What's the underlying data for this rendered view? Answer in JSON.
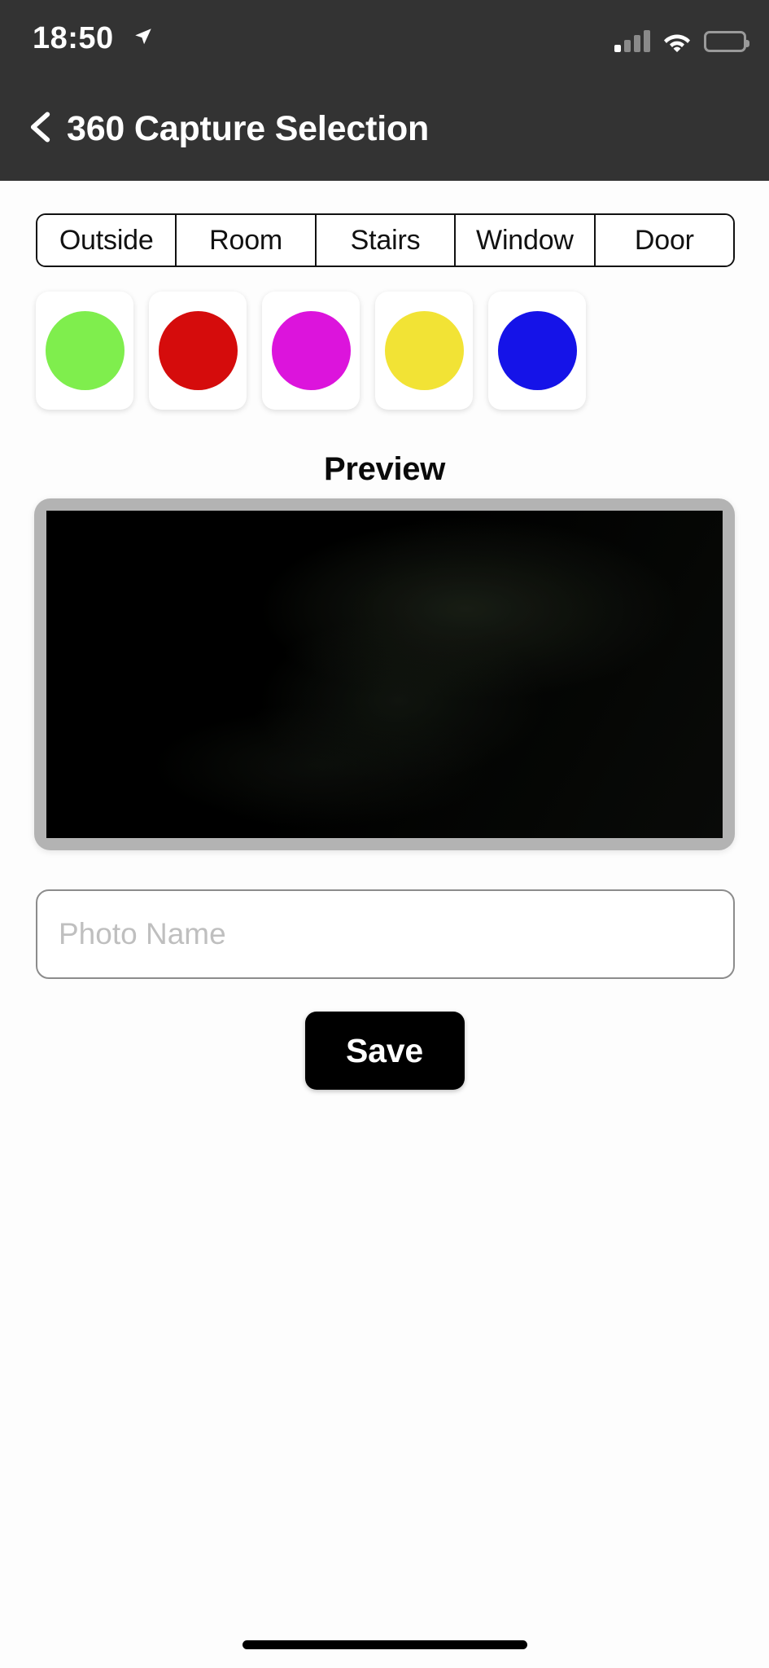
{
  "status_bar": {
    "time": "18:50",
    "location_icon": "location-arrow-icon",
    "signal_icon": "cellular-signal-icon",
    "signal_bars_active": 1,
    "signal_bars_total": 4,
    "wifi_icon": "wifi-icon",
    "battery_icon": "battery-icon",
    "battery_level_percent": 15,
    "battery_color": "#f01c1c",
    "background": "#333333"
  },
  "navbar": {
    "back_icon": "chevron-left-icon",
    "title": "360 Capture Selection",
    "background": "#333333",
    "text_color": "#ffffff"
  },
  "segmented_control": {
    "options": [
      {
        "label": "Outside"
      },
      {
        "label": "Room"
      },
      {
        "label": "Stairs"
      },
      {
        "label": "Window"
      },
      {
        "label": "Door"
      }
    ],
    "border_color": "#111111"
  },
  "color_swatches": [
    {
      "name": "green",
      "color": "#7fee4d"
    },
    {
      "name": "red",
      "color": "#d50c0c"
    },
    {
      "name": "magenta",
      "color": "#dc14dc"
    },
    {
      "name": "yellow",
      "color": "#f2e335"
    },
    {
      "name": "blue",
      "color": "#1513e8"
    }
  ],
  "preview": {
    "heading": "Preview",
    "frame_color": "#b3b3b3",
    "image_description": "dark-photo-thumbnail"
  },
  "photo_name_field": {
    "value": "",
    "placeholder": "Photo Name",
    "border_color": "#8c8c8c",
    "placeholder_color": "#bfbfbf"
  },
  "save_button": {
    "label": "Save",
    "background": "#000000",
    "text_color": "#ffffff"
  },
  "home_indicator": {
    "color": "#000000"
  }
}
